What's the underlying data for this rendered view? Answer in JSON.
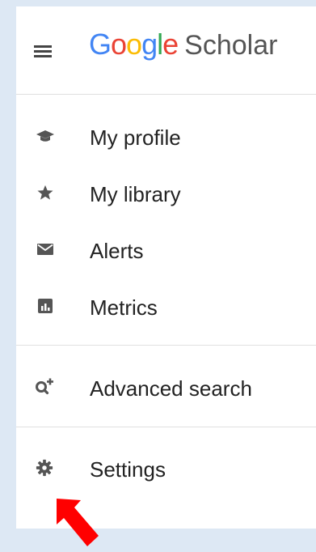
{
  "header": {
    "menu_icon": "hamburger-menu-icon",
    "logo": {
      "letters": [
        {
          "char": "G",
          "color": "#4285F4"
        },
        {
          "char": "o",
          "color": "#EA4335"
        },
        {
          "char": "o",
          "color": "#FBBC05"
        },
        {
          "char": "g",
          "color": "#4285F4"
        },
        {
          "char": "l",
          "color": "#34A853"
        },
        {
          "char": "e",
          "color": "#EA4335"
        }
      ],
      "product": "Scholar"
    }
  },
  "menu": {
    "my_profile": {
      "label": "My profile",
      "icon": "graduation-cap-icon"
    },
    "my_library": {
      "label": "My library",
      "icon": "star-icon"
    },
    "alerts": {
      "label": "Alerts",
      "icon": "envelope-icon"
    },
    "metrics": {
      "label": "Metrics",
      "icon": "bar-chart-icon"
    },
    "advanced_search": {
      "label": "Advanced search",
      "icon": "search-plus-icon"
    },
    "settings": {
      "label": "Settings",
      "icon": "gear-icon"
    }
  },
  "annotation": {
    "arrow_color": "#ff0000",
    "arrow_icon": "red-arrow-pointer-icon"
  }
}
